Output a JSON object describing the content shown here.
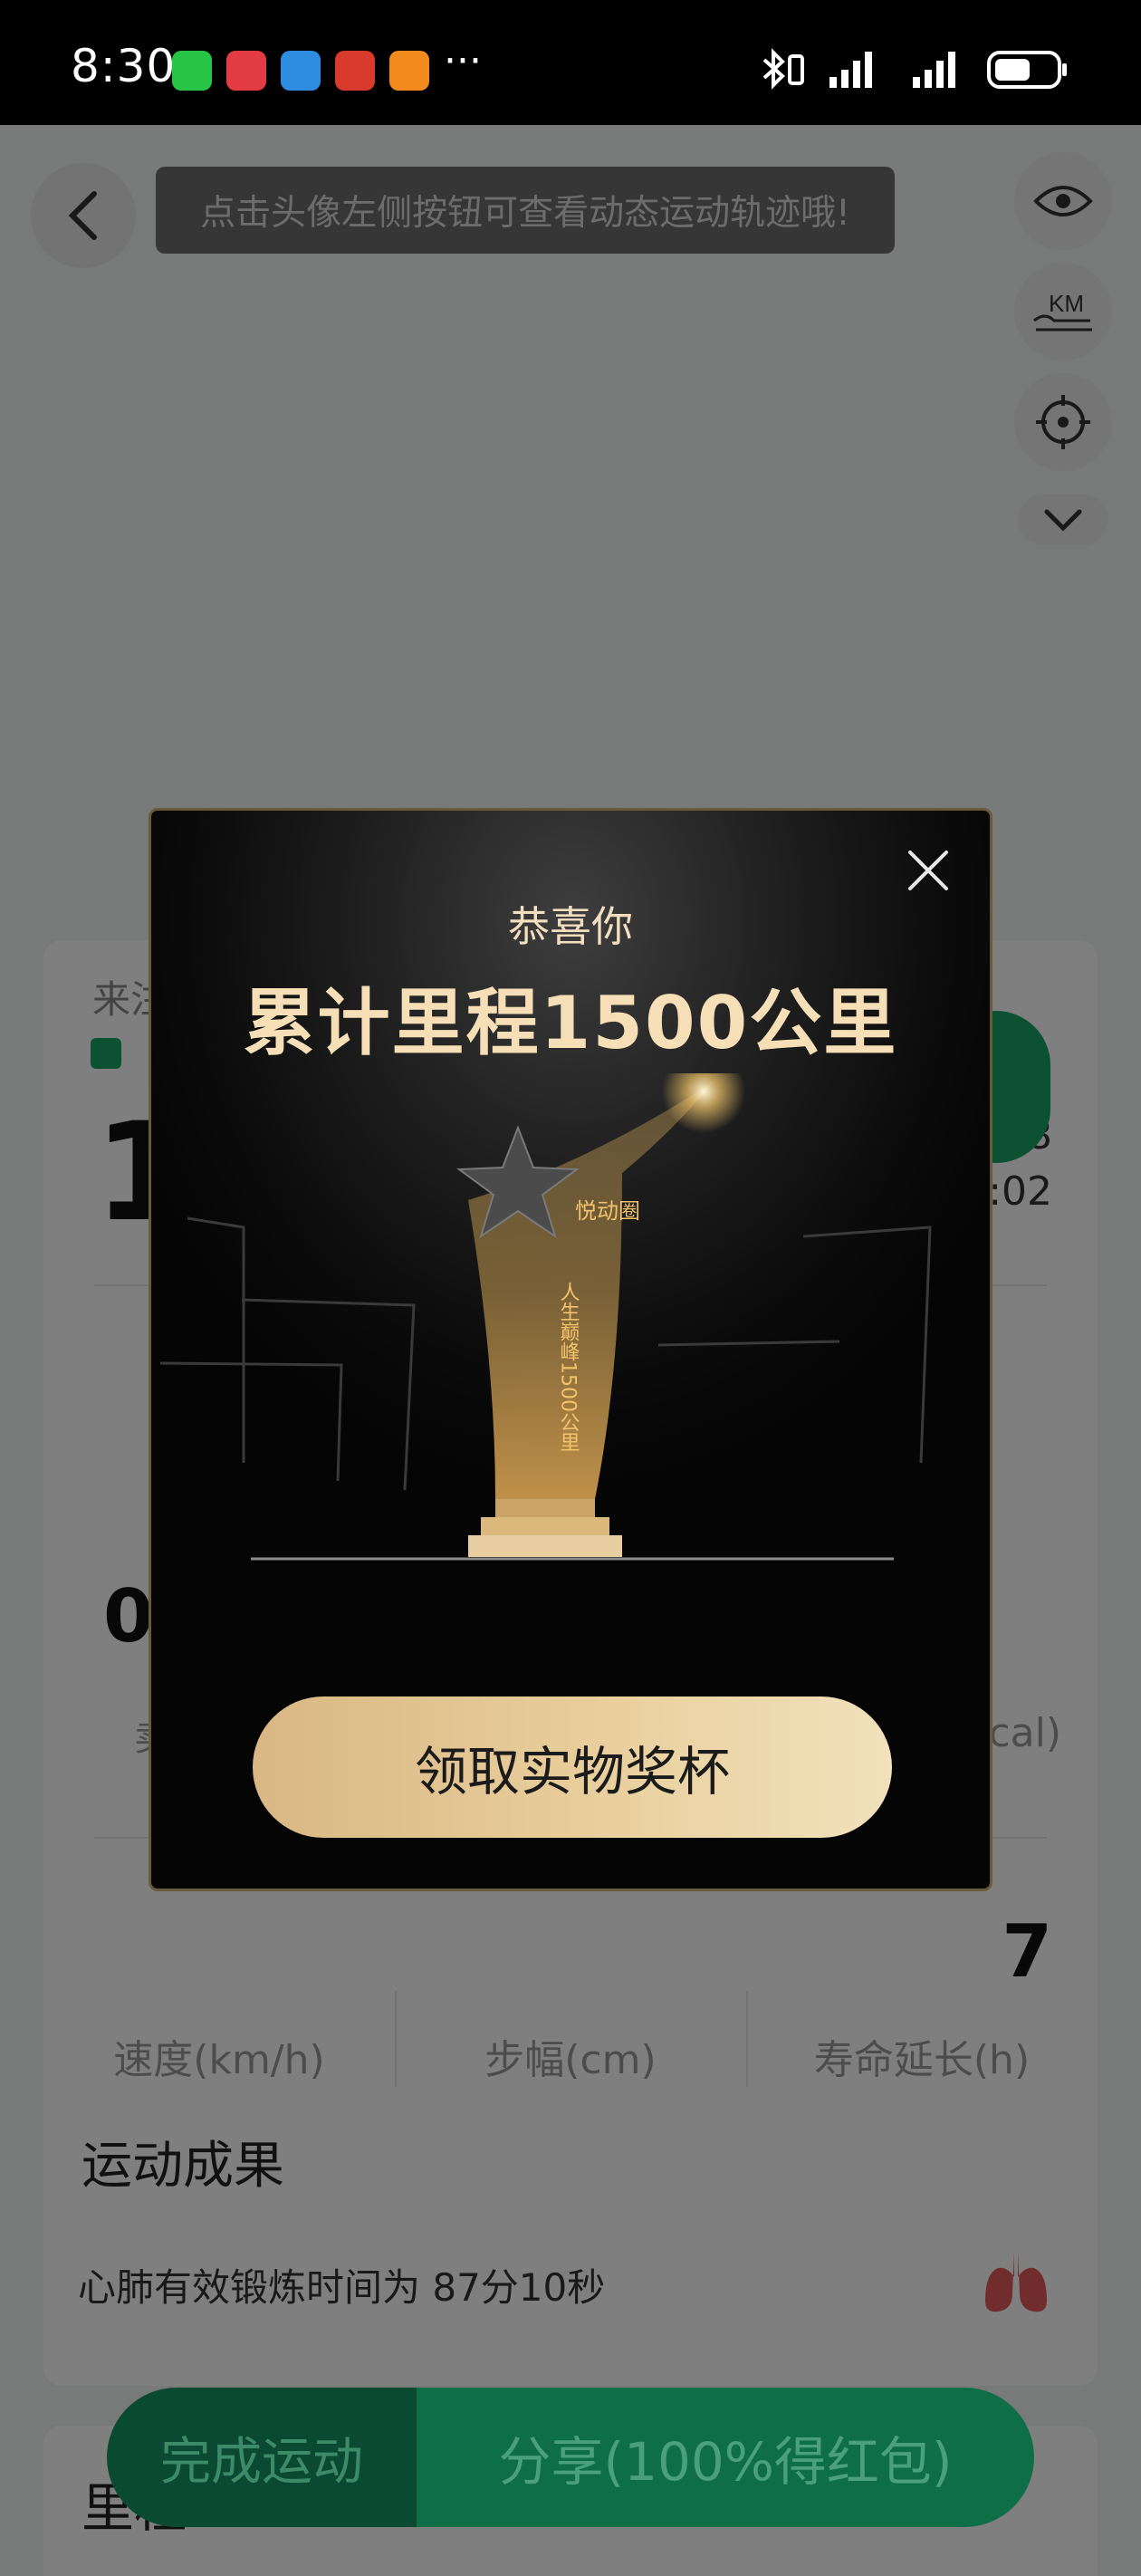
{
  "status_bar": {
    "time": "8:30",
    "more": "···"
  },
  "map": {
    "hint_text": "点击头像左侧按钮可查看动态运动轨迹哦!",
    "km_label": "KM"
  },
  "summary": {
    "source_label": "来注",
    "main_value": "1",
    "side_value_1": "378",
    "side_value_2": ":02",
    "stat_value_left": "0",
    "stat_unit_left": "卖",
    "stat_unit_right": "cal)",
    "stat_value_right": "7",
    "speed_label": "速度(km/h)",
    "stride_label": "步幅(cm)",
    "life_label": "寿命延长(h)"
  },
  "results": {
    "title": "运动成果",
    "lung_text": "心肺有效锻炼时间为 87分10秒"
  },
  "next_card": {
    "title": "里程"
  },
  "actions": {
    "finish_label": "完成运动",
    "share_label": "分享(100%得红包)"
  },
  "modal": {
    "subtitle": "恭喜你",
    "title": "累计里程1500公里",
    "claim_label": "领取实物奖杯",
    "trophy_text": "人生巅峰1500公里",
    "trophy_brand": "悦动圈"
  },
  "colors": {
    "accent_green": "#1aa367",
    "gold": "#f6dfb6"
  }
}
